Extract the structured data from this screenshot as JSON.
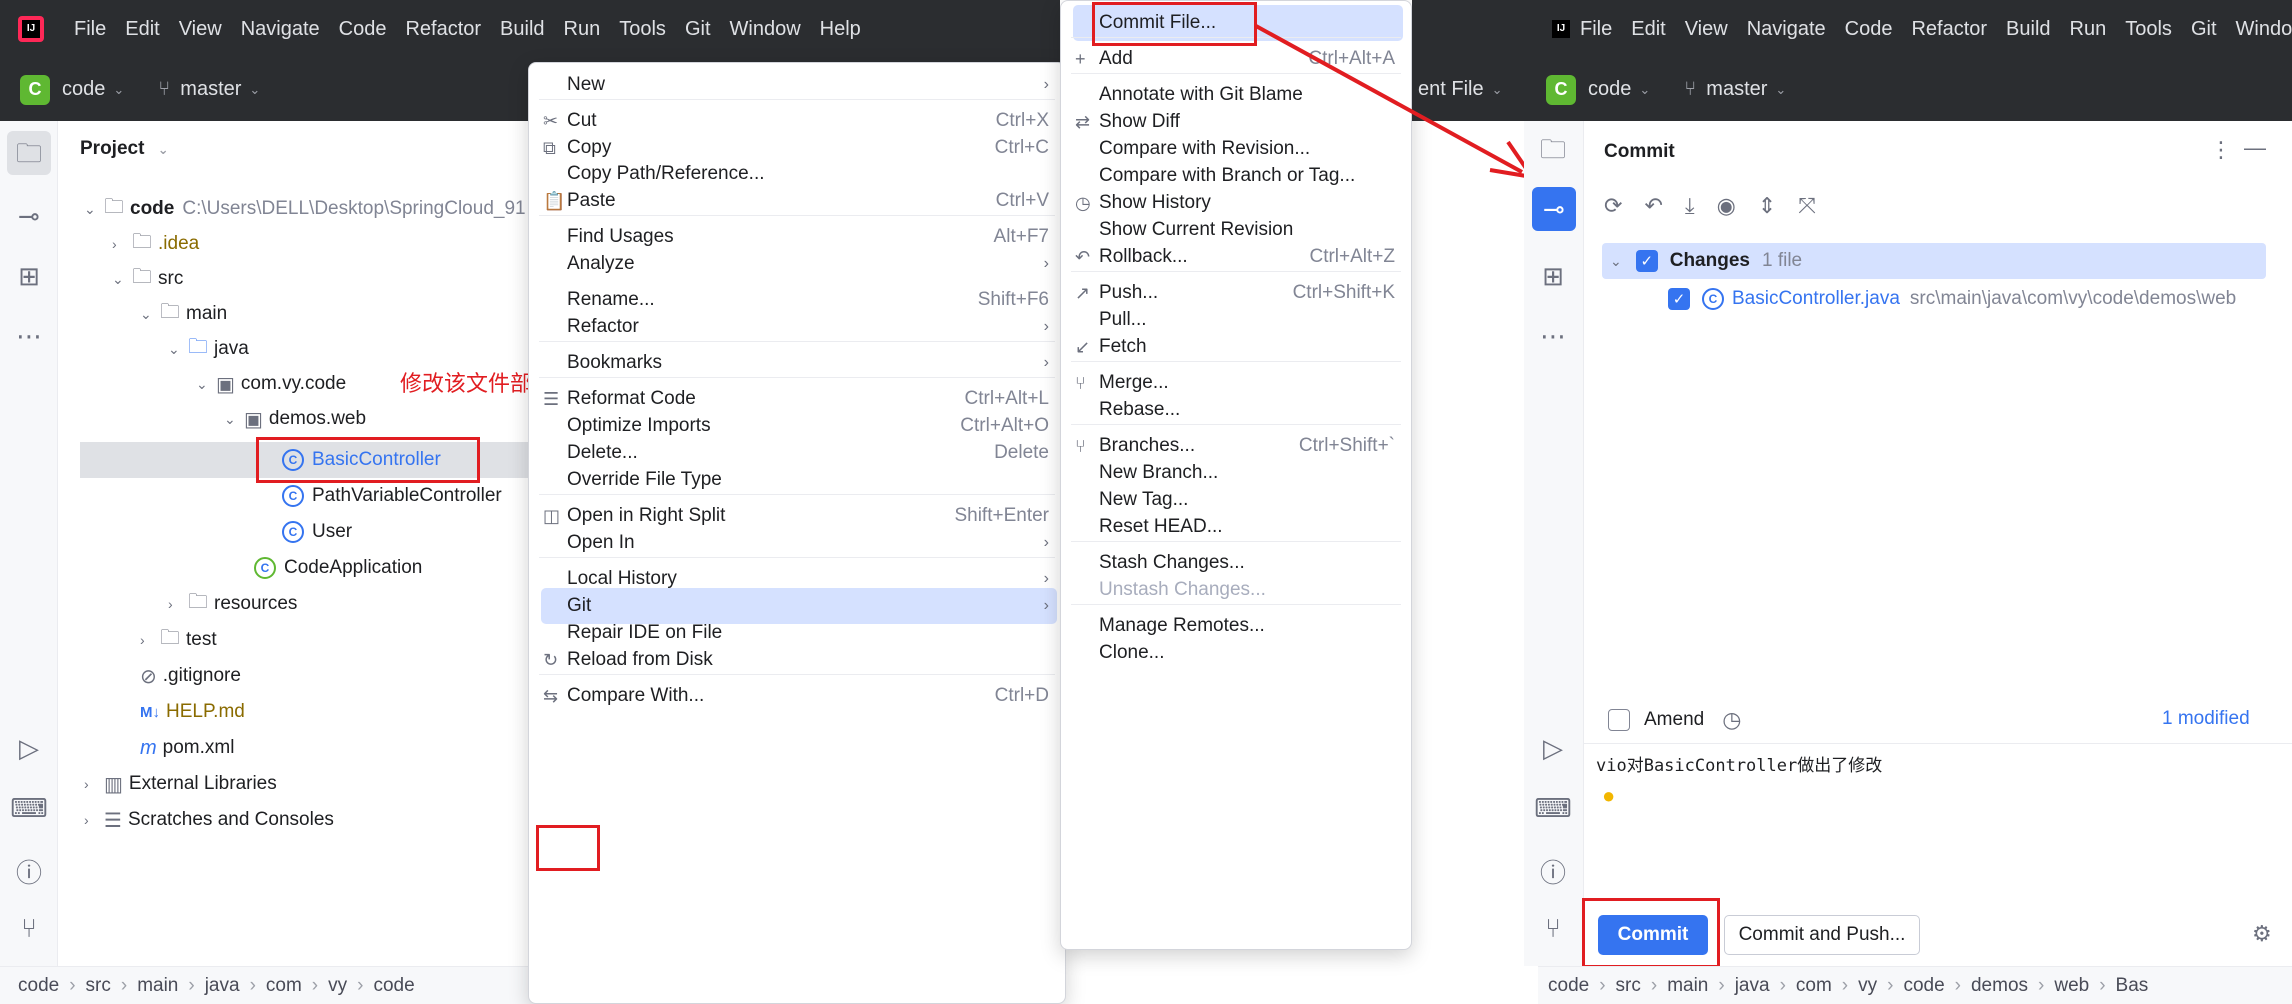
{
  "left_window": {
    "menubar": [
      "File",
      "Edit",
      "View",
      "Navigate",
      "Code",
      "Refactor",
      "Build",
      "Run",
      "Tools",
      "Git",
      "Window",
      "Help"
    ],
    "project_name": "code",
    "branch": "master",
    "panel_title": "Project",
    "tree": {
      "root_name": "code",
      "root_path": "C:\\Users\\DELL\\Desktop\\SpringCloud_91",
      "idea": ".idea",
      "src": "src",
      "main": "main",
      "java": "java",
      "pkg": "com.vy.code",
      "demos": "demos.web",
      "basic": "BasicController",
      "pathvar": "PathVariableController",
      "user": "User",
      "app": "CodeApplication",
      "resources": "resources",
      "test": "test",
      "gitignore": ".gitignore",
      "helpmd": "HELP.md",
      "pom": "pom.xml",
      "extlibs": "External Libraries",
      "scratches": "Scratches and Consoles"
    },
    "annotation": "修改该文件部分代码，右键",
    "statusbar": [
      "code",
      "src",
      "main",
      "java",
      "com",
      "vy",
      "code"
    ]
  },
  "context_menu": [
    {
      "label": "New",
      "shortcut": "",
      "submenu": true
    },
    {
      "label": "Cut",
      "shortcut": "Ctrl+X",
      "icon": "✂"
    },
    {
      "label": "Copy",
      "shortcut": "Ctrl+C",
      "icon": "⧉"
    },
    {
      "label": "Copy Path/Reference...",
      "shortcut": ""
    },
    {
      "label": "Paste",
      "shortcut": "Ctrl+V",
      "icon": "📋"
    },
    {
      "label": "Find Usages",
      "shortcut": "Alt+F7"
    },
    {
      "label": "Analyze",
      "shortcut": "",
      "submenu": true
    },
    {
      "label": "Rename...",
      "shortcut": "Shift+F6"
    },
    {
      "label": "Refactor",
      "shortcut": "",
      "submenu": true
    },
    {
      "label": "Bookmarks",
      "shortcut": "",
      "submenu": true
    },
    {
      "label": "Reformat Code",
      "shortcut": "Ctrl+Alt+L",
      "icon": "☰"
    },
    {
      "label": "Optimize Imports",
      "shortcut": "Ctrl+Alt+O"
    },
    {
      "label": "Delete...",
      "shortcut": "Delete"
    },
    {
      "label": "Override File Type",
      "shortcut": ""
    },
    {
      "label": "Open in Right Split",
      "shortcut": "Shift+Enter",
      "icon": "◫"
    },
    {
      "label": "Open In",
      "shortcut": "",
      "submenu": true
    },
    {
      "label": "Local History",
      "shortcut": "",
      "submenu": true
    },
    {
      "label": "Git",
      "shortcut": "",
      "submenu": true
    },
    {
      "label": "Repair IDE on File",
      "shortcut": ""
    },
    {
      "label": "Reload from Disk",
      "shortcut": "",
      "icon": "↻"
    },
    {
      "label": "Compare With...",
      "shortcut": "Ctrl+D",
      "icon": "⇆"
    }
  ],
  "git_menu": [
    {
      "label": "Commit File...",
      "shortcut": ""
    },
    {
      "label": "Add",
      "shortcut": "Ctrl+Alt+A",
      "icon": "+"
    },
    {
      "label": "Annotate with Git Blame",
      "shortcut": ""
    },
    {
      "label": "Show Diff",
      "shortcut": "",
      "icon": "⇄"
    },
    {
      "label": "Compare with Revision...",
      "shortcut": ""
    },
    {
      "label": "Compare with Branch or Tag...",
      "shortcut": ""
    },
    {
      "label": "Show History",
      "shortcut": "",
      "icon": "◷"
    },
    {
      "label": "Show Current Revision",
      "shortcut": ""
    },
    {
      "label": "Rollback...",
      "shortcut": "Ctrl+Alt+Z",
      "icon": "↶"
    },
    {
      "label": "Push...",
      "shortcut": "Ctrl+Shift+K",
      "icon": "↗"
    },
    {
      "label": "Pull...",
      "shortcut": ""
    },
    {
      "label": "Fetch",
      "shortcut": "",
      "icon": "↙"
    },
    {
      "label": "Merge...",
      "shortcut": "",
      "icon": "⑂"
    },
    {
      "label": "Rebase...",
      "shortcut": ""
    },
    {
      "label": "Branches...",
      "shortcut": "Ctrl+Shift+`",
      "icon": "⑂"
    },
    {
      "label": "New Branch...",
      "shortcut": ""
    },
    {
      "label": "New Tag...",
      "shortcut": ""
    },
    {
      "label": "Reset HEAD...",
      "shortcut": ""
    },
    {
      "label": "Stash Changes...",
      "shortcut": ""
    },
    {
      "label": "Unstash Changes...",
      "shortcut": "",
      "disabled": true
    },
    {
      "label": "Manage Remotes...",
      "shortcut": ""
    },
    {
      "label": "Clone...",
      "shortcut": ""
    }
  ],
  "behind_text": "ent File",
  "right_window": {
    "menubar": [
      "File",
      "Edit",
      "View",
      "Navigate",
      "Code",
      "Refactor",
      "Build",
      "Run",
      "Tools",
      "Git",
      "Window"
    ],
    "project_name": "code",
    "branch": "master",
    "panel_title": "Commit",
    "changes_label": "Changes",
    "changes_count": "1 file",
    "file_name": "BasicController.java",
    "file_path": "src\\main\\java\\com\\vy\\code\\demos\\web",
    "amend_label": "Amend",
    "modified_label": "1 modified",
    "commit_message": "vio对BasicController做出了修改",
    "commit_button": "Commit",
    "commit_push_button": "Commit and Push...",
    "statusbar": [
      "code",
      "src",
      "main",
      "java",
      "com",
      "vy",
      "code",
      "demos",
      "web",
      "Bas"
    ]
  },
  "colors": {
    "accent": "#3574f0",
    "annotation_red": "#e11d21",
    "dark_bar": "#2b2d30",
    "menu_highlight": "#d5e1ff"
  }
}
